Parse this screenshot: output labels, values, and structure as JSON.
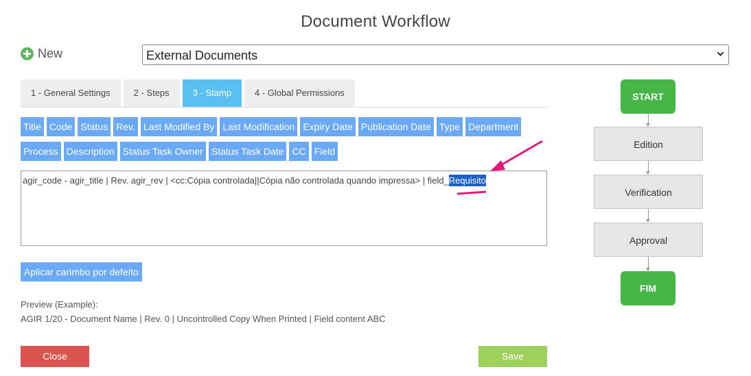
{
  "page": {
    "title": "Document Workflow"
  },
  "new_button": {
    "label": "New"
  },
  "workflow_select": {
    "value": "External Documents"
  },
  "tabs": [
    {
      "label": "1 - General Settings",
      "active": false
    },
    {
      "label": "2 - Steps",
      "active": false
    },
    {
      "label": "3 - Stamp",
      "active": true
    },
    {
      "label": "4 - Global Permissions",
      "active": false
    }
  ],
  "field_buttons": {
    "row1": [
      "Title",
      "Code",
      "Status",
      "Rev.",
      "Last Modified By",
      "Last Modification",
      "Expiry Date",
      "Publication Date",
      "Type",
      "Department"
    ],
    "row2": [
      "Process",
      "Description",
      "Status Task Owner",
      "Status Task Date",
      "CC",
      "Field"
    ]
  },
  "stamp": {
    "text_before": "agir_code - agir_title | Rev. agir_rev | <cc:Cópia controlada||Cópia não controlada quando impressa> | field_",
    "selected_text": "Requisito"
  },
  "default_button": {
    "label": "Aplicar carimbo por defeito"
  },
  "preview": {
    "label": "Preview (Example):",
    "text": "AGIR 1/20 - Document Name | Rev. 0 | Uncontrolled Copy When Printed | Field content ABC"
  },
  "actions": {
    "close": "Close",
    "save": "Save"
  },
  "workflow_diagram": {
    "start": "START",
    "steps": [
      "Edition",
      "Verification",
      "Approval"
    ],
    "end": "FIM"
  },
  "colors": {
    "tab_active": "#5bc0f0",
    "field_button": "#6aa9f5",
    "close": "#d9534f",
    "save": "#9dd05c",
    "workflow_terminal": "#46b649",
    "annotation_arrow": "#e8177a",
    "selection": "#1d5fc8"
  }
}
